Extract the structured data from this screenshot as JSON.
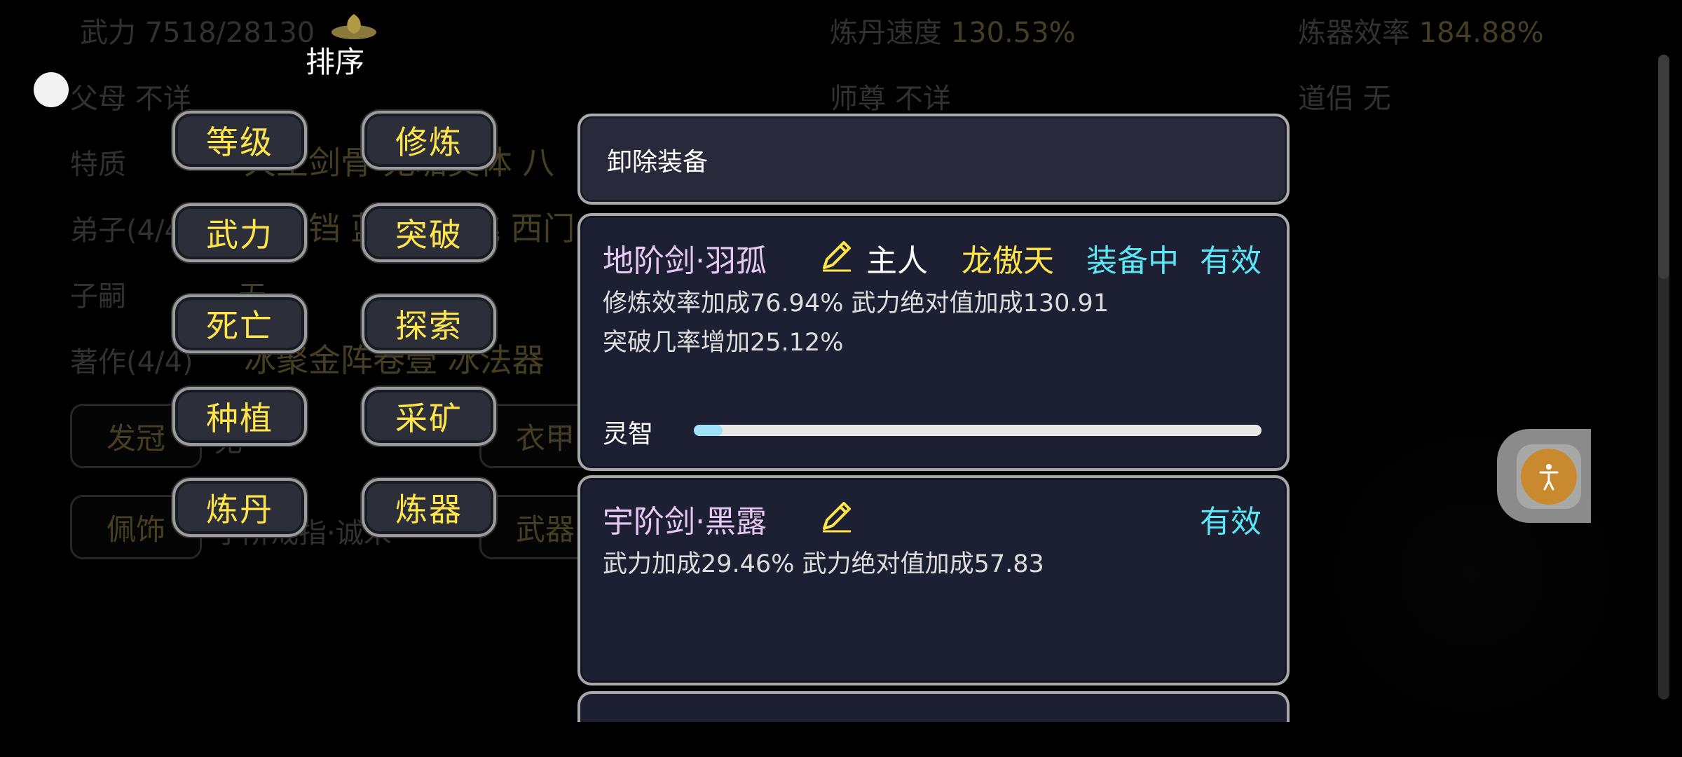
{
  "background": {
    "stats": {
      "wuli": "武力 7518/28130",
      "liandan_speed_label": "炼丹速度",
      "liandan_speed_value": "130.53%",
      "lianqi_eff_label": "炼器效率",
      "lianqi_eff_value": "184.88%"
    },
    "rows": {
      "fumu": "父母 不详",
      "shizun": "师尊  不详",
      "daolv": "道侣  无",
      "tezhi_label": "特质",
      "tezhi_value": "天生剑骨 无垢灵体 八",
      "dizi_label": "弟子(4/4)",
      "dizi_value": "柯铃铛 蓝·恩 亢桃 西门·",
      "zisi_label": "子嗣",
      "zisi_value": "无",
      "zhuzuo_label": "著作(4/4)",
      "zhuzuo_value": "冰聚金阵卷壹 冰法器"
    },
    "equip_slots": {
      "faguan": "发冠",
      "faguan_value": "无",
      "yijia": "衣甲",
      "peishi": "佩饰",
      "peishi_value": "宇阶戒指·诚米",
      "wuqi": "武器"
    }
  },
  "sort_menu": {
    "title": "排序",
    "buttons": [
      "等级",
      "修炼",
      "武力",
      "突破",
      "死亡",
      "探索",
      "种植",
      "采矿",
      "炼丹",
      "炼器"
    ]
  },
  "panel": {
    "unequip_label": "卸除装备",
    "items": [
      {
        "name": "地阶剑·羽孤",
        "owner_label": "主人",
        "owner_name": "龙傲天",
        "equipped_label": "装备中",
        "status": "有效",
        "stat_line1": "修炼效率加成76.94% 武力绝对值加成130.91",
        "stat_line2": "突破几率增加25.12%",
        "intelligence_label": "灵智",
        "intelligence_fraction": 0.05
      },
      {
        "name": "宇阶剑·黑露",
        "status": "有效",
        "stat_line1": "武力加成29.46% 武力绝对值加成57.83"
      }
    ]
  },
  "colors": {
    "accent_yellow": "#ffe54a",
    "accent_cyan": "#5ae6f5",
    "item_name": "#e7c8f2",
    "panel_bg": "#1d2032"
  },
  "icons": {
    "edit": "pencil-icon",
    "sort": "lotus-icon",
    "assistive": "accessibility-icon"
  }
}
